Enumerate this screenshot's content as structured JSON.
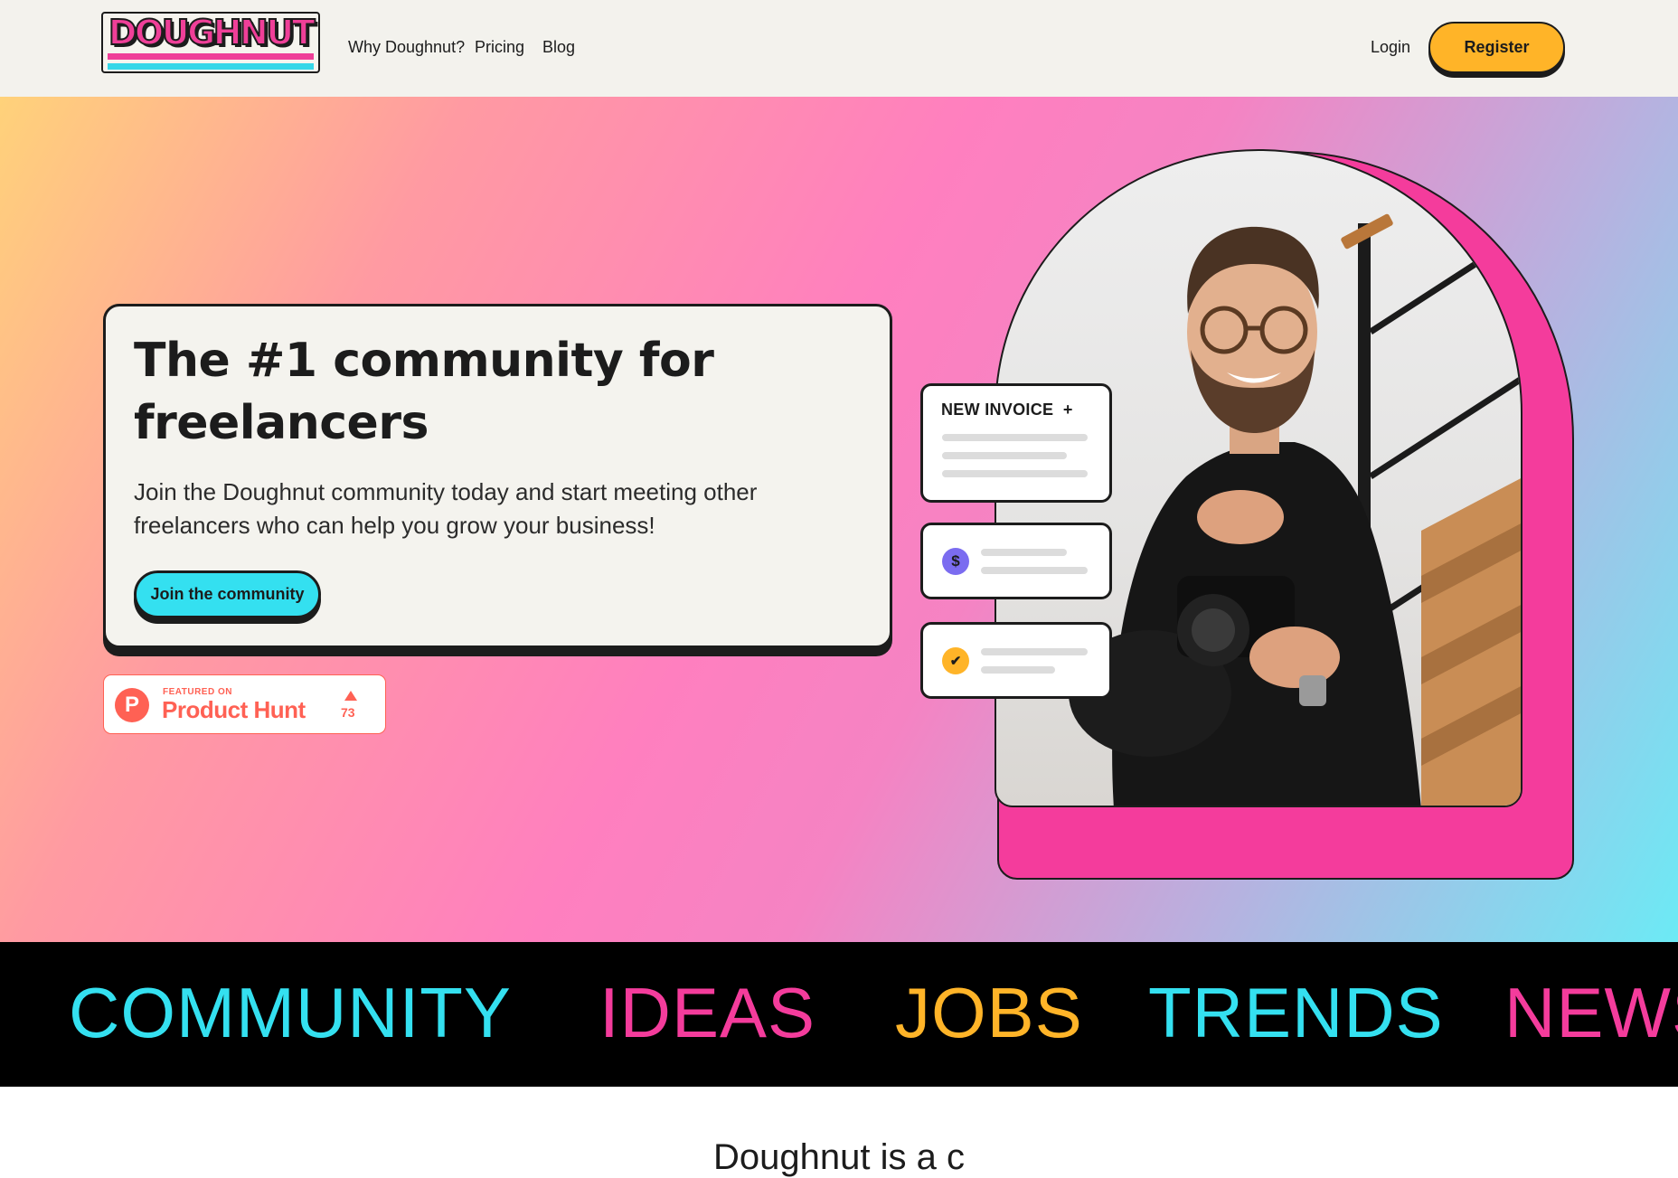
{
  "nav": {
    "logo_text": "DOUGHNUT",
    "links": [
      "Why Doughnut?",
      "Pricing",
      "Blog"
    ],
    "login_label": "Login",
    "register_label": "Register"
  },
  "hero": {
    "title": "The #1 community for freelancers",
    "description": "Join the Doughnut community today and start meeting other freelancers who can help you grow your business!",
    "cta_label": "Join the community",
    "product_hunt": {
      "featured_label": "FEATURED ON",
      "name": "Product Hunt",
      "logo_letter": "P",
      "upvotes": "73"
    },
    "invoice_card_title": "NEW INVOICE",
    "invoice_plus": "+",
    "payment_symbol": "$",
    "check_symbol": "✔"
  },
  "ticker": {
    "words": [
      {
        "text": "COMMUNITY",
        "color": "#34e0f0"
      },
      {
        "text": "IDEAS",
        "color": "#f43c9c"
      },
      {
        "text": "JOBS",
        "color": "#ffb428"
      },
      {
        "text": "TRENDS",
        "color": "#34e0f0"
      },
      {
        "text": "NEWS",
        "color": "#f43c9c"
      }
    ]
  },
  "below": {
    "heading_partial": "Doughnut is a c"
  },
  "colors": {
    "accent_yellow": "#ffb428",
    "accent_pink": "#f43c9c",
    "accent_cyan": "#34e0f0",
    "ink": "#1c1c1c",
    "product_hunt": "#ff6154"
  }
}
